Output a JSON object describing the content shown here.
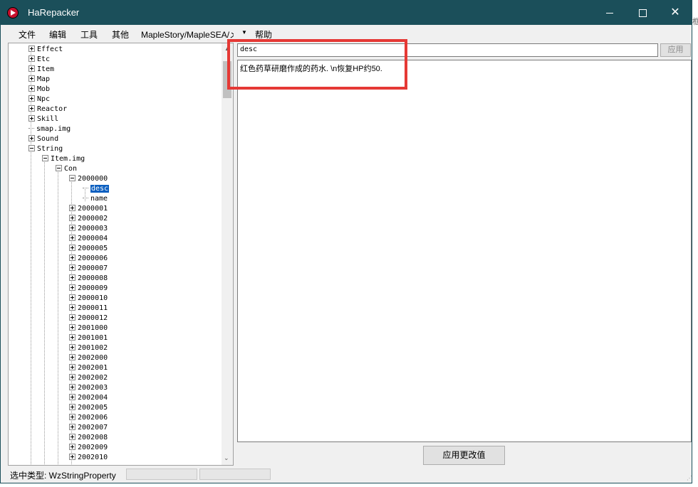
{
  "window": {
    "title": "HaRepacker"
  },
  "menu": {
    "file": "文件",
    "edit": "编辑",
    "tools": "工具",
    "other": "其他",
    "path": "MapleStory/MapleSEA/メ",
    "help": "帮助"
  },
  "tree": {
    "nodes": [
      {
        "label": "Effect",
        "expander": "plus"
      },
      {
        "label": "Etc",
        "expander": "plus"
      },
      {
        "label": "Item",
        "expander": "plus"
      },
      {
        "label": "Map",
        "expander": "plus"
      },
      {
        "label": "Mob",
        "expander": "plus"
      },
      {
        "label": "Npc",
        "expander": "plus"
      },
      {
        "label": "Reactor",
        "expander": "plus"
      },
      {
        "label": "Skill",
        "expander": "plus"
      },
      {
        "label": "smap.img",
        "expander": "leaf"
      },
      {
        "label": "Sound",
        "expander": "plus"
      },
      {
        "label": "String",
        "expander": "minus"
      },
      {
        "label": "Item.img",
        "expander": "minus"
      },
      {
        "label": "Con",
        "expander": "minus"
      },
      {
        "label": "2000000",
        "expander": "minus"
      },
      {
        "label": "desc",
        "expander": "leaf",
        "selected": true
      },
      {
        "label": "name",
        "expander": "leaf"
      },
      {
        "label": "2000001",
        "expander": "plus"
      },
      {
        "label": "2000002",
        "expander": "plus"
      },
      {
        "label": "2000003",
        "expander": "plus"
      },
      {
        "label": "2000004",
        "expander": "plus"
      },
      {
        "label": "2000005",
        "expander": "plus"
      },
      {
        "label": "2000006",
        "expander": "plus"
      },
      {
        "label": "2000007",
        "expander": "plus"
      },
      {
        "label": "2000008",
        "expander": "plus"
      },
      {
        "label": "2000009",
        "expander": "plus"
      },
      {
        "label": "2000010",
        "expander": "plus"
      },
      {
        "label": "2000011",
        "expander": "plus"
      },
      {
        "label": "2000012",
        "expander": "plus"
      },
      {
        "label": "2001000",
        "expander": "plus"
      },
      {
        "label": "2001001",
        "expander": "plus"
      },
      {
        "label": "2001002",
        "expander": "plus"
      },
      {
        "label": "2002000",
        "expander": "plus"
      },
      {
        "label": "2002001",
        "expander": "plus"
      },
      {
        "label": "2002002",
        "expander": "plus"
      },
      {
        "label": "2002003",
        "expander": "plus"
      },
      {
        "label": "2002004",
        "expander": "plus"
      },
      {
        "label": "2002005",
        "expander": "plus"
      },
      {
        "label": "2002006",
        "expander": "plus"
      },
      {
        "label": "2002007",
        "expander": "plus"
      },
      {
        "label": "2002008",
        "expander": "plus"
      },
      {
        "label": "2002009",
        "expander": "plus"
      },
      {
        "label": "2002010",
        "expander": "plus"
      }
    ]
  },
  "editor": {
    "key_value": "desc",
    "apply_label": "应用",
    "value_text": "红色药草研磨作成的药水. \\n恢复HP约50.",
    "apply_changes_label": "应用更改值"
  },
  "status": {
    "selected_type": "选中类型: WzStringProperty"
  },
  "colors": {
    "titlebar": "#1b4f5a",
    "selection": "#0b5fc0",
    "highlight": "#e53935"
  }
}
